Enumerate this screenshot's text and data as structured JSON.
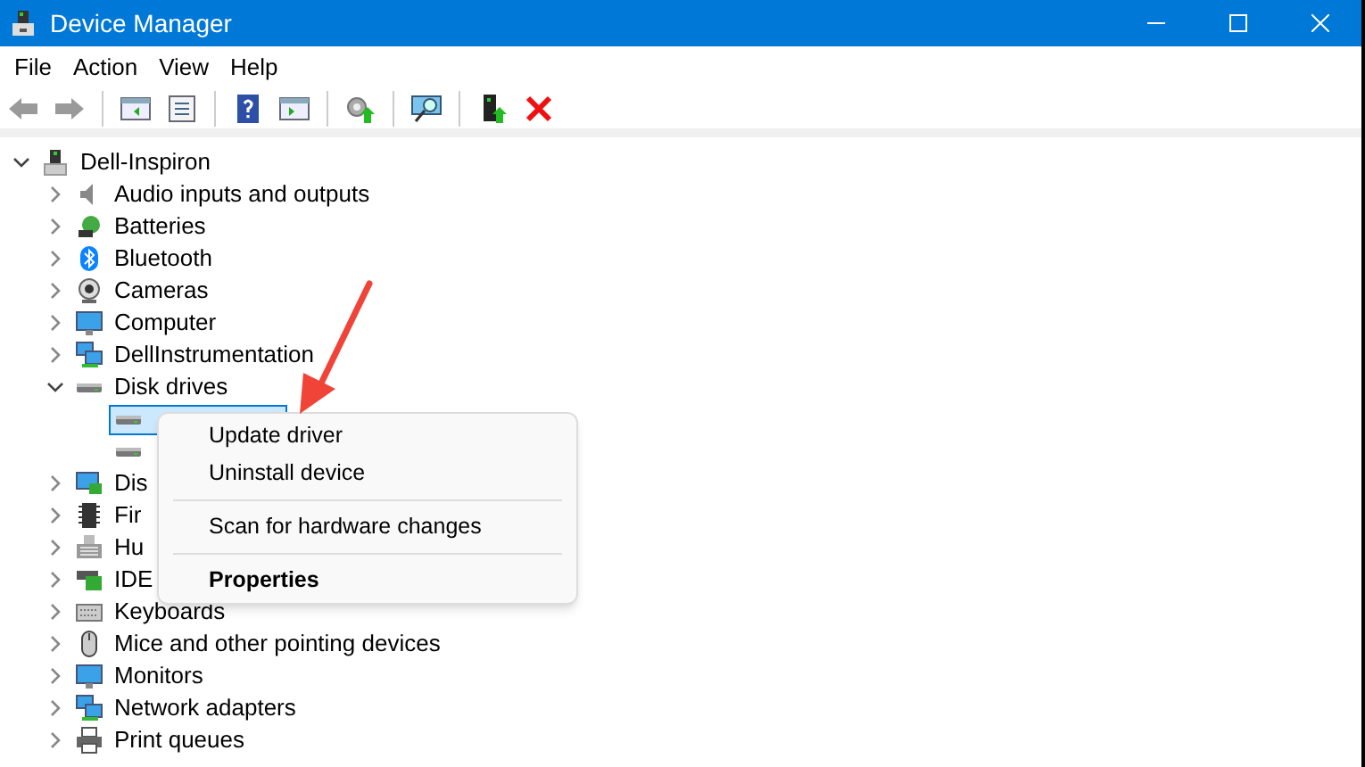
{
  "window": {
    "title": "Device Manager"
  },
  "menu": [
    "File",
    "Action",
    "View",
    "Help"
  ],
  "toolbar": [
    {
      "kind": "back",
      "disabled": true
    },
    {
      "kind": "forward",
      "disabled": true
    },
    {
      "kind": "separator"
    },
    {
      "kind": "console-tree"
    },
    {
      "kind": "properties"
    },
    {
      "kind": "separator"
    },
    {
      "kind": "help"
    },
    {
      "kind": "action-pane"
    },
    {
      "kind": "separator"
    },
    {
      "kind": "update"
    },
    {
      "kind": "separator"
    },
    {
      "kind": "scan"
    },
    {
      "kind": "separator"
    },
    {
      "kind": "enable"
    },
    {
      "kind": "uninstall"
    }
  ],
  "tree": {
    "label": "Dell-Inspiron",
    "kind": "pc",
    "expanded": true,
    "children": [
      {
        "label": "Audio inputs and outputs",
        "kind": "speaker",
        "expanded": false
      },
      {
        "label": "Batteries",
        "kind": "battery",
        "expanded": false
      },
      {
        "label": "Bluetooth",
        "kind": "bluetooth",
        "expanded": false
      },
      {
        "label": "Cameras",
        "kind": "camera",
        "expanded": false
      },
      {
        "label": "Computer",
        "kind": "monitor",
        "expanded": false
      },
      {
        "label": "DellInstrumentation",
        "kind": "network",
        "expanded": false
      },
      {
        "label": "Disk drives",
        "kind": "disk",
        "expanded": true,
        "children": [
          {
            "kind": "disk",
            "selected": true
          },
          {
            "kind": "disk",
            "selected": false
          }
        ]
      },
      {
        "label": "Dis",
        "kind": "display",
        "expanded": false
      },
      {
        "label": "Fir",
        "kind": "chip",
        "expanded": false
      },
      {
        "label": "Hu",
        "kind": "hid",
        "expanded": false
      },
      {
        "label": "IDE",
        "kind": "ide",
        "expanded": false
      },
      {
        "label": "Keyboards",
        "kind": "keyboard",
        "expanded": false
      },
      {
        "label": "Mice and other pointing devices",
        "kind": "mouse",
        "expanded": false
      },
      {
        "label": "Monitors",
        "kind": "monitor",
        "expanded": false
      },
      {
        "label": "Network adapters",
        "kind": "network",
        "expanded": false
      },
      {
        "label": "Print queues",
        "kind": "printer",
        "expanded": false
      }
    ]
  },
  "context_menu": [
    {
      "kind": "item",
      "label": "Update driver"
    },
    {
      "kind": "item",
      "label": "Uninstall device"
    },
    {
      "kind": "separator"
    },
    {
      "kind": "item",
      "label": "Scan for hardware changes"
    },
    {
      "kind": "separator"
    },
    {
      "kind": "default",
      "label": "Properties"
    }
  ]
}
